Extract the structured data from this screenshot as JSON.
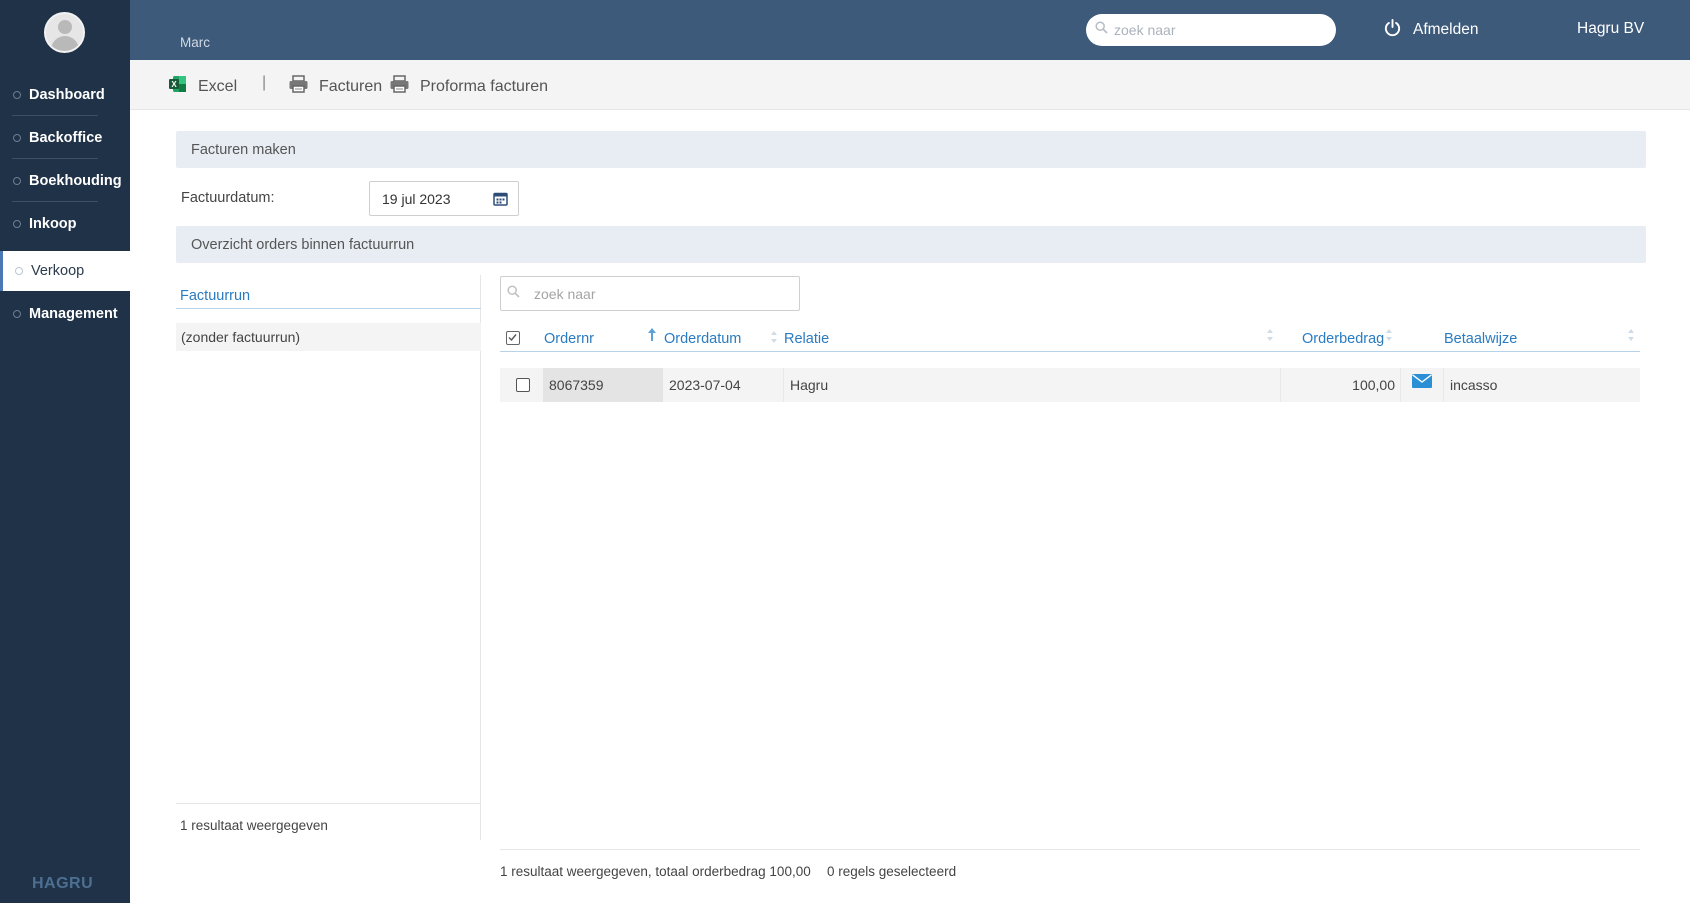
{
  "user": {
    "name": "Marc"
  },
  "sidebar": {
    "items": [
      {
        "label": "Dashboard",
        "active": false
      },
      {
        "label": "Backoffice",
        "active": false
      },
      {
        "label": "Boekhouding",
        "active": false
      },
      {
        "label": "Inkoop",
        "active": false
      },
      {
        "label": "Verkoop",
        "active": true
      },
      {
        "label": "Management",
        "active": false
      }
    ],
    "logo_text": "HAGRU"
  },
  "header": {
    "search_placeholder": "zoek naar",
    "logout_label": "Afmelden",
    "company": "Hagru BV"
  },
  "toolbar": {
    "excel_label": "Excel",
    "separator": "|",
    "invoices_label": "Facturen",
    "proforma_label": "Proforma facturen"
  },
  "create_panel": {
    "title": "Facturen maken",
    "date_label": "Factuurdatum:",
    "date_value": "19 jul 2023"
  },
  "overview_panel": {
    "title": "Overzicht orders binnen factuurrun"
  },
  "run_list": {
    "header": "Factuurrun",
    "items": [
      "(zonder factuurrun)"
    ],
    "footer": "1 resultaat weergegeven"
  },
  "orders_table": {
    "search_placeholder": "zoek naar",
    "columns": [
      "Ordernr",
      "Orderdatum",
      "Relatie",
      "Orderbedrag",
      "Betaalwijze"
    ],
    "rows": [
      {
        "ordernr": "8067359",
        "orderdatum": "2023-07-04",
        "relatie": "Hagru",
        "orderbedrag": "100,00",
        "betaalwijze": "incasso",
        "icon": "envelope-icon"
      }
    ],
    "footer_summary": "1 resultaat weergegeven, totaal orderbedrag 100,00",
    "footer_selected": "0 regels geselecteerd"
  },
  "colors": {
    "sidebar_bg": "#1f3247",
    "header_bg": "#3d5a7a",
    "link_blue": "#2a7bc0",
    "panel_bg": "#e8edf3"
  }
}
